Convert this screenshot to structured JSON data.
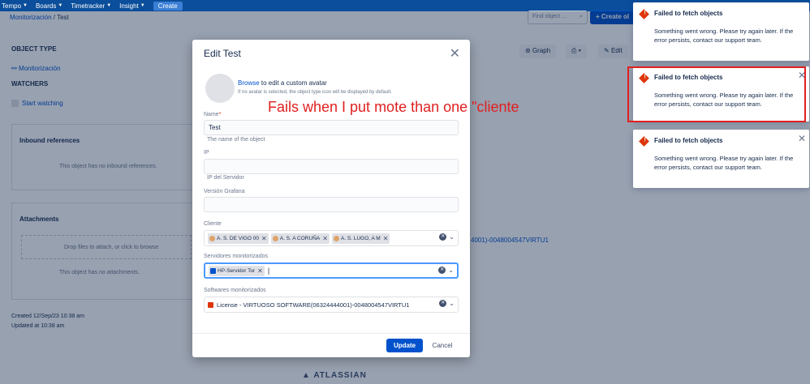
{
  "topnav": {
    "items": [
      {
        "label": "Tempo"
      },
      {
        "label": "Boards"
      },
      {
        "label": "Timetracker"
      },
      {
        "label": "Insight"
      }
    ],
    "create_label": "Create"
  },
  "page": {
    "breadcrumb_root": "Monitorización",
    "breadcrumb_sep": " / ",
    "breadcrumb_current": "Test",
    "find_placeholder": "Find object ...",
    "create_object_label": "+ Create ol",
    "object_type_title": "OBJECT TYPE",
    "object_type_link": "Monitorización",
    "watchers_title": "WATCHERS",
    "start_watching": "Start watching",
    "graph_button": "Graph",
    "edit_button": "Edit",
    "inbound_title": "Inbound references",
    "inbound_empty": "This object has no inbound references.",
    "attachments_title": "Attachments",
    "drop_hint": "Drop files to attach, or click to browse",
    "attachments_empty": "This object has no attachments.",
    "bg_license_fragment": "4001)-0048004547VIRTU1",
    "created": "Created 12/Sep/23 10:38 am",
    "updated": "Updated at 10:38 am",
    "atlassian": "ATLASSIAN"
  },
  "modal": {
    "title": "Edit Test",
    "avatar_browse": "Browse",
    "avatar_text": " to edit a custom avatar",
    "avatar_note": "If no avatar is selected, the object type icon will be displayed by default.",
    "name_label": "Name",
    "name_req": "*",
    "name_value": "Test",
    "name_help": "The name of the object",
    "ip_label": "IP",
    "ip_value": "",
    "ip_help": "IP del Servidor",
    "grafana_label": "Versión Grafana",
    "grafana_value": "",
    "cliente_label": "Cliente",
    "cliente_tags": [
      "A. S. DE VIGO 00",
      "A. S. A CORUÑA",
      "A. S. LUGO, A M"
    ],
    "servidores_label": "Servidores monitorizados",
    "servidores_tags": [
      "HP-Servidor Tor"
    ],
    "softwares_label": "Softwares monitorizados",
    "softwares_value": "License - VIRTUOSO SOFTWARE(06324444001)-0048004547VIRTU1",
    "update_label": "Update",
    "cancel_label": "Cancel"
  },
  "annotation": "Fails when I put mote than one \"cliente",
  "toasts": [
    {
      "title": "Failed to fetch objects",
      "body": "Something went wrong. Please try again later. If the error persists, contact our support team."
    },
    {
      "title": "Failed to fetch objects",
      "body": "Something went wrong. Please try again later. If the error persists, contact our support team."
    },
    {
      "title": "Failed to fetch objects",
      "body": "Something went wrong. Please try again later. If the error persists, contact our support team."
    }
  ]
}
